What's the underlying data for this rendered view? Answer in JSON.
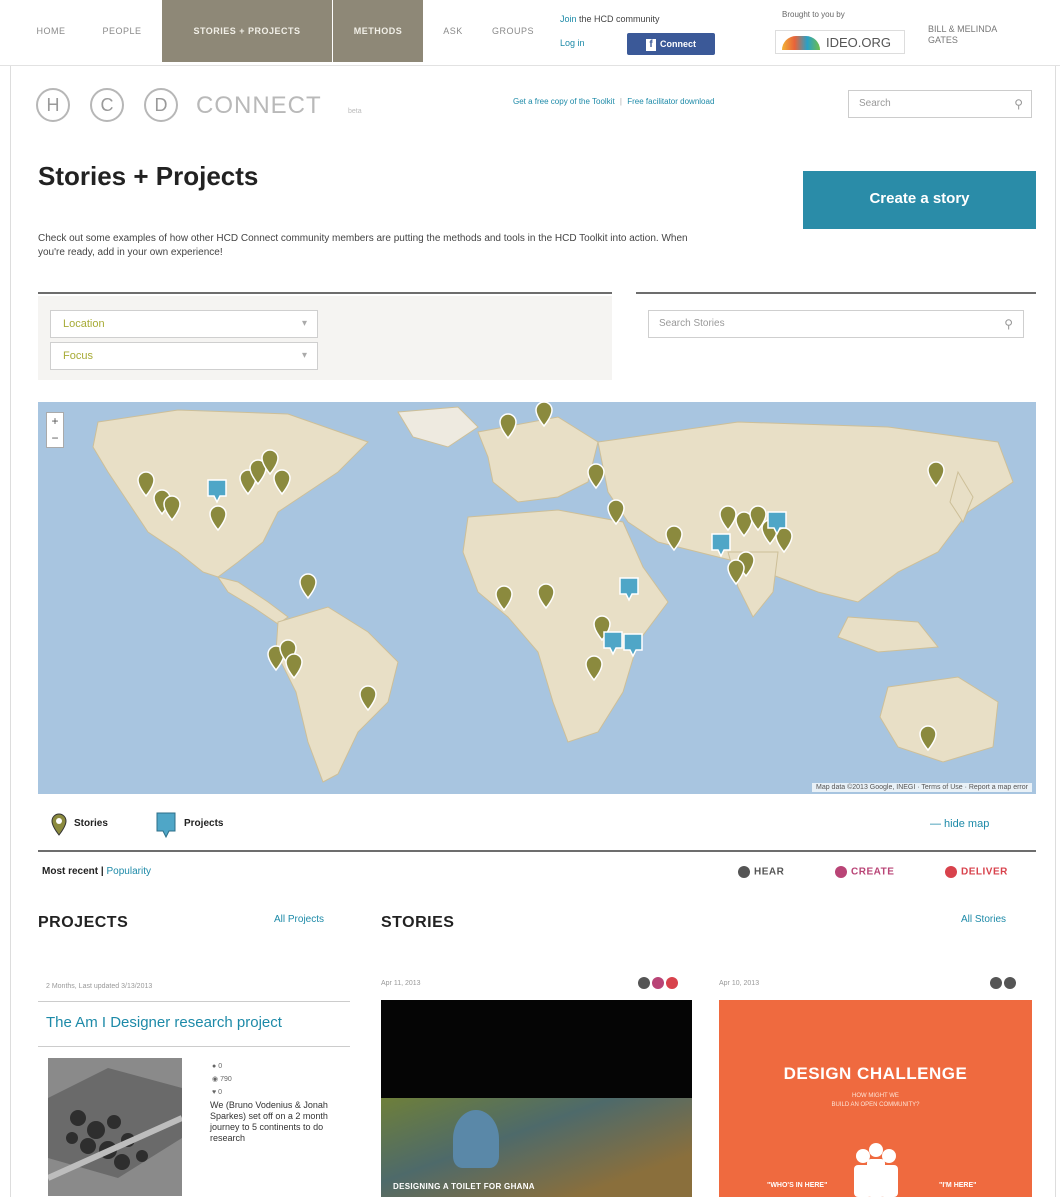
{
  "topnav": {
    "tabs": [
      "HOME",
      "PEOPLE",
      "STORIES + PROJECTS",
      "METHODS",
      "ASK",
      "GROUPS"
    ],
    "join_prefix": "Join",
    "join_suffix": "the HCD community",
    "login": "Log in",
    "facebook": "Connect",
    "brought_by": "Brought to you by",
    "partner_logo": "IDEO.ORG",
    "partner_tagline": "BILL & MELINDA GATES"
  },
  "header": {
    "logo_letters": [
      "H",
      "C",
      "D"
    ],
    "logo_word": "CONNECT",
    "logo_beta": "beta",
    "link_free_copy": "Get a free copy of the Toolkit",
    "link_divider": "|",
    "link_facilitator": "Free facilitator download",
    "search_placeholder": "Search"
  },
  "page": {
    "title": "Stories + Projects",
    "create_button": "Create a story",
    "intro": "Check out some examples of how other HCD Connect community members are putting the methods and tools in the HCD Toolkit into action. When you're ready, add in your own experience!"
  },
  "filters": {
    "location": "Location",
    "focus": "Focus",
    "search_stories_placeholder": "Search Stories"
  },
  "map": {
    "zoom_in": "+",
    "zoom_out": "−",
    "attribution": "Map data ©2013 Google, INEGI · Terms of Use · Report a map error",
    "ocean_color": "#a8c5e0",
    "land_color": "#e8dfc6",
    "story_pin_color": "#8b8a3e",
    "project_pin_color": "#4fa6c7"
  },
  "legend": {
    "stories": "Stories",
    "projects": "Projects",
    "hide_map": "— hide map"
  },
  "sort": {
    "most_recent": "Most recent",
    "divider": "|",
    "popularity": "Popularity"
  },
  "phases": {
    "hear": "HEAR",
    "create": "CREATE",
    "deliver": "DELIVER"
  },
  "projects": {
    "title": "PROJECTS",
    "all_link": "All Projects",
    "card": {
      "meta": "2 Months, Last updated 3/13/2013",
      "title": "The Am I Designer research project",
      "stats": [
        "0",
        "790",
        "0"
      ],
      "description": "We (Bruno Vodenius & Jonah Sparkes) set off on a 2 month journey to 5 continents to do research"
    }
  },
  "stories": {
    "title": "STORIES",
    "all_link": "All Stories",
    "cards": [
      {
        "date": "Apr 11, 2013",
        "caption": "DESIGNING A TOILET FOR GHANA"
      },
      {
        "date": "Apr 10, 2013",
        "big": "DESIGN CHALLENGE",
        "sub1": "HOW MIGHT WE",
        "sub2": "BUILD AN OPEN COMMUNITY?",
        "left_caption": "\"WHO'S IN HERE\"",
        "right_caption": "\"I'M HERE\""
      }
    ]
  }
}
